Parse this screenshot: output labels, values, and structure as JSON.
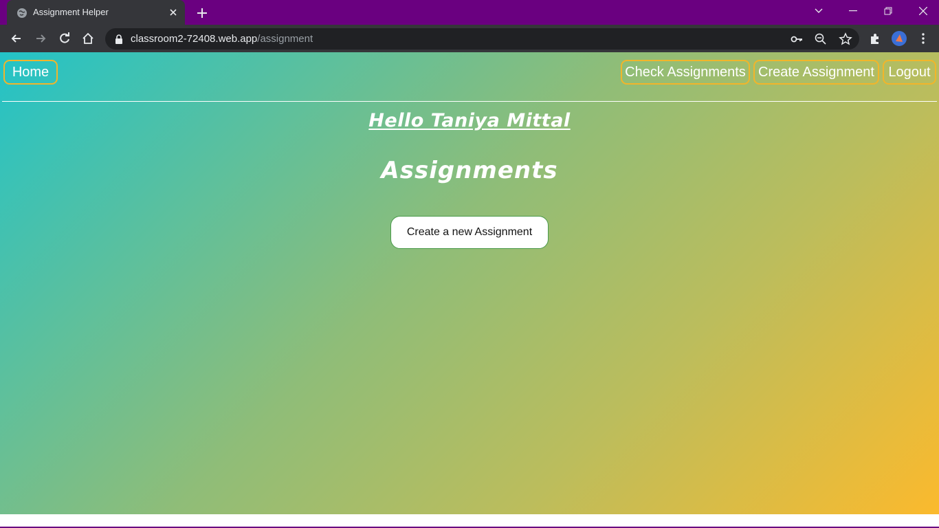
{
  "browser": {
    "tab_title": "Assignment Helper",
    "url_host": "classroom2-72408.web.app",
    "url_path": "/assignment",
    "accent": "#6a0080"
  },
  "nav": {
    "home": "Home",
    "check_assignments": "Check Assignments",
    "create_assignment": "Create Assignment",
    "logout": "Logout",
    "border_color": "#f2b52a"
  },
  "main": {
    "greeting": "Hello Taniya Mittal",
    "heading": "Assignments",
    "create_button": "Create a new Assignment"
  },
  "colors": {
    "gradient_start": "#23c3c7",
    "gradient_end": "#fbba2d"
  }
}
